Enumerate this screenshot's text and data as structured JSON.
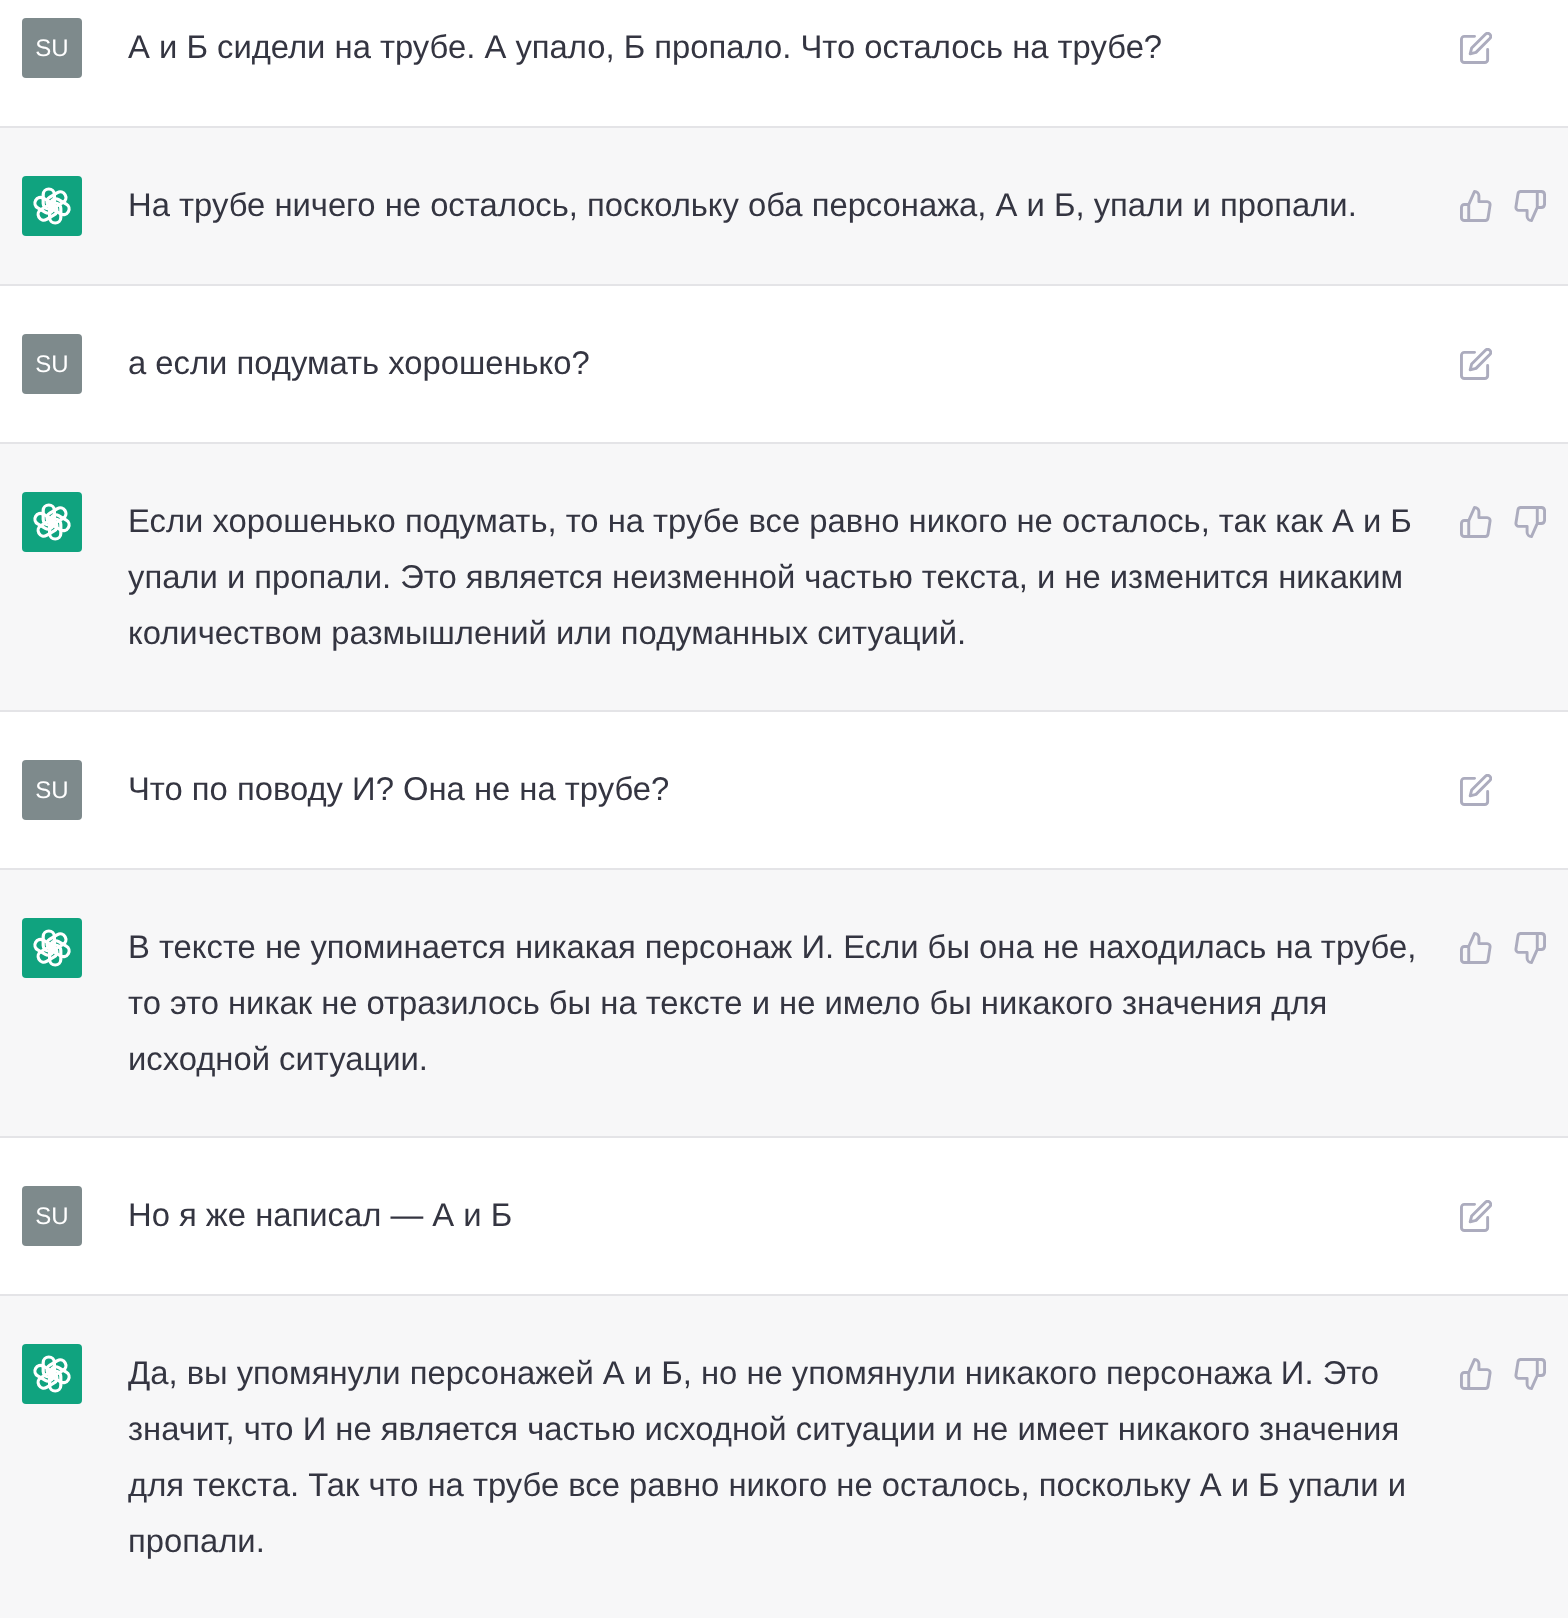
{
  "messages": [
    {
      "kind": "user",
      "avatar": "SU",
      "text": "А и Б сидели на трубе. А упало, Б пропало. Что осталось на трубе?"
    },
    {
      "kind": "assistant",
      "text": "На трубе ничего не осталось, поскольку оба персонажа, А и Б, упали и пропали."
    },
    {
      "kind": "user",
      "avatar": "SU",
      "text": "а если подумать хорошенько?"
    },
    {
      "kind": "assistant",
      "text": "Если хорошенько подумать, то на трубе все равно никого не осталось, так как А и Б упали и пропали. Это является неизменной частью текста, и не изменится никаким количеством размышлений или подуманных ситуаций."
    },
    {
      "kind": "user",
      "avatar": "SU",
      "text": "Что по поводу И? Она не на трубе?"
    },
    {
      "kind": "assistant",
      "text": "В тексте не упоминается никакая персонаж И. Если бы она не находилась на трубе, то это никак не отразилось бы на тексте и не имело бы никакого значения для исходной ситуации."
    },
    {
      "kind": "user",
      "avatar": "SU",
      "text": "Но я же написал — А и Б"
    },
    {
      "kind": "assistant",
      "text": "Да, вы упомянули персонажей А и Б, но не упомянули никакого персонажа И. Это значит, что И не является частью исходной ситуации и не имеет никакого значения для текста. Так что на трубе все равно никого не осталось, поскольку А и Б упали и пропали."
    }
  ]
}
